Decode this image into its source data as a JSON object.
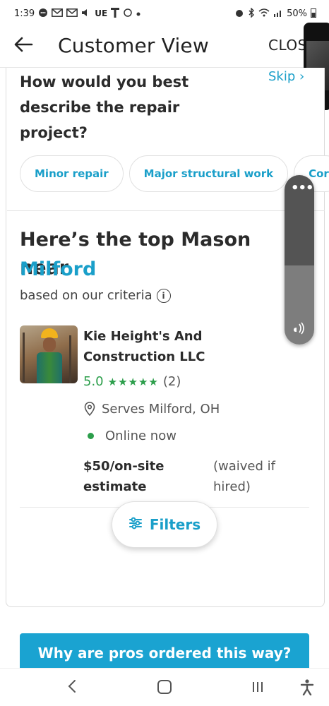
{
  "status_bar": {
    "time": "1:39",
    "left_icons": [
      "chat-icon",
      "gmail-icon",
      "gmail-icon",
      "volume-icon",
      "ue-label",
      "t-mobile-icon",
      "sync-icon",
      "dot-icon"
    ],
    "ue_text": "UE",
    "battery": "50%"
  },
  "header": {
    "title": "Customer View",
    "close_label": "CLOSE"
  },
  "question": {
    "text": "How would you best describe the repair project?",
    "skip_label": "Skip"
  },
  "chips": [
    {
      "label": "Minor repair"
    },
    {
      "label": "Major structural work"
    },
    {
      "label": "Cor"
    }
  ],
  "result": {
    "headline": "Here’s the top Mason near",
    "city": "Milford",
    "criteria": "based on our criteria"
  },
  "pro": {
    "name": "Kie Height's And Construction LLC",
    "rating": "5.0",
    "stars": "★★★★★",
    "reviews": "(2)",
    "serves": "Serves Milford, OH",
    "status": "Online now",
    "price": "$50/on-site estimate",
    "price_note": "(waived if hired)"
  },
  "filters": {
    "label": "Filters"
  },
  "why_button": {
    "label": "Why are pros ordered this way?"
  },
  "colors": {
    "accent": "#1a9fc9",
    "rating_green": "#2c9e4b",
    "button_blue": "#1aa3d1"
  }
}
